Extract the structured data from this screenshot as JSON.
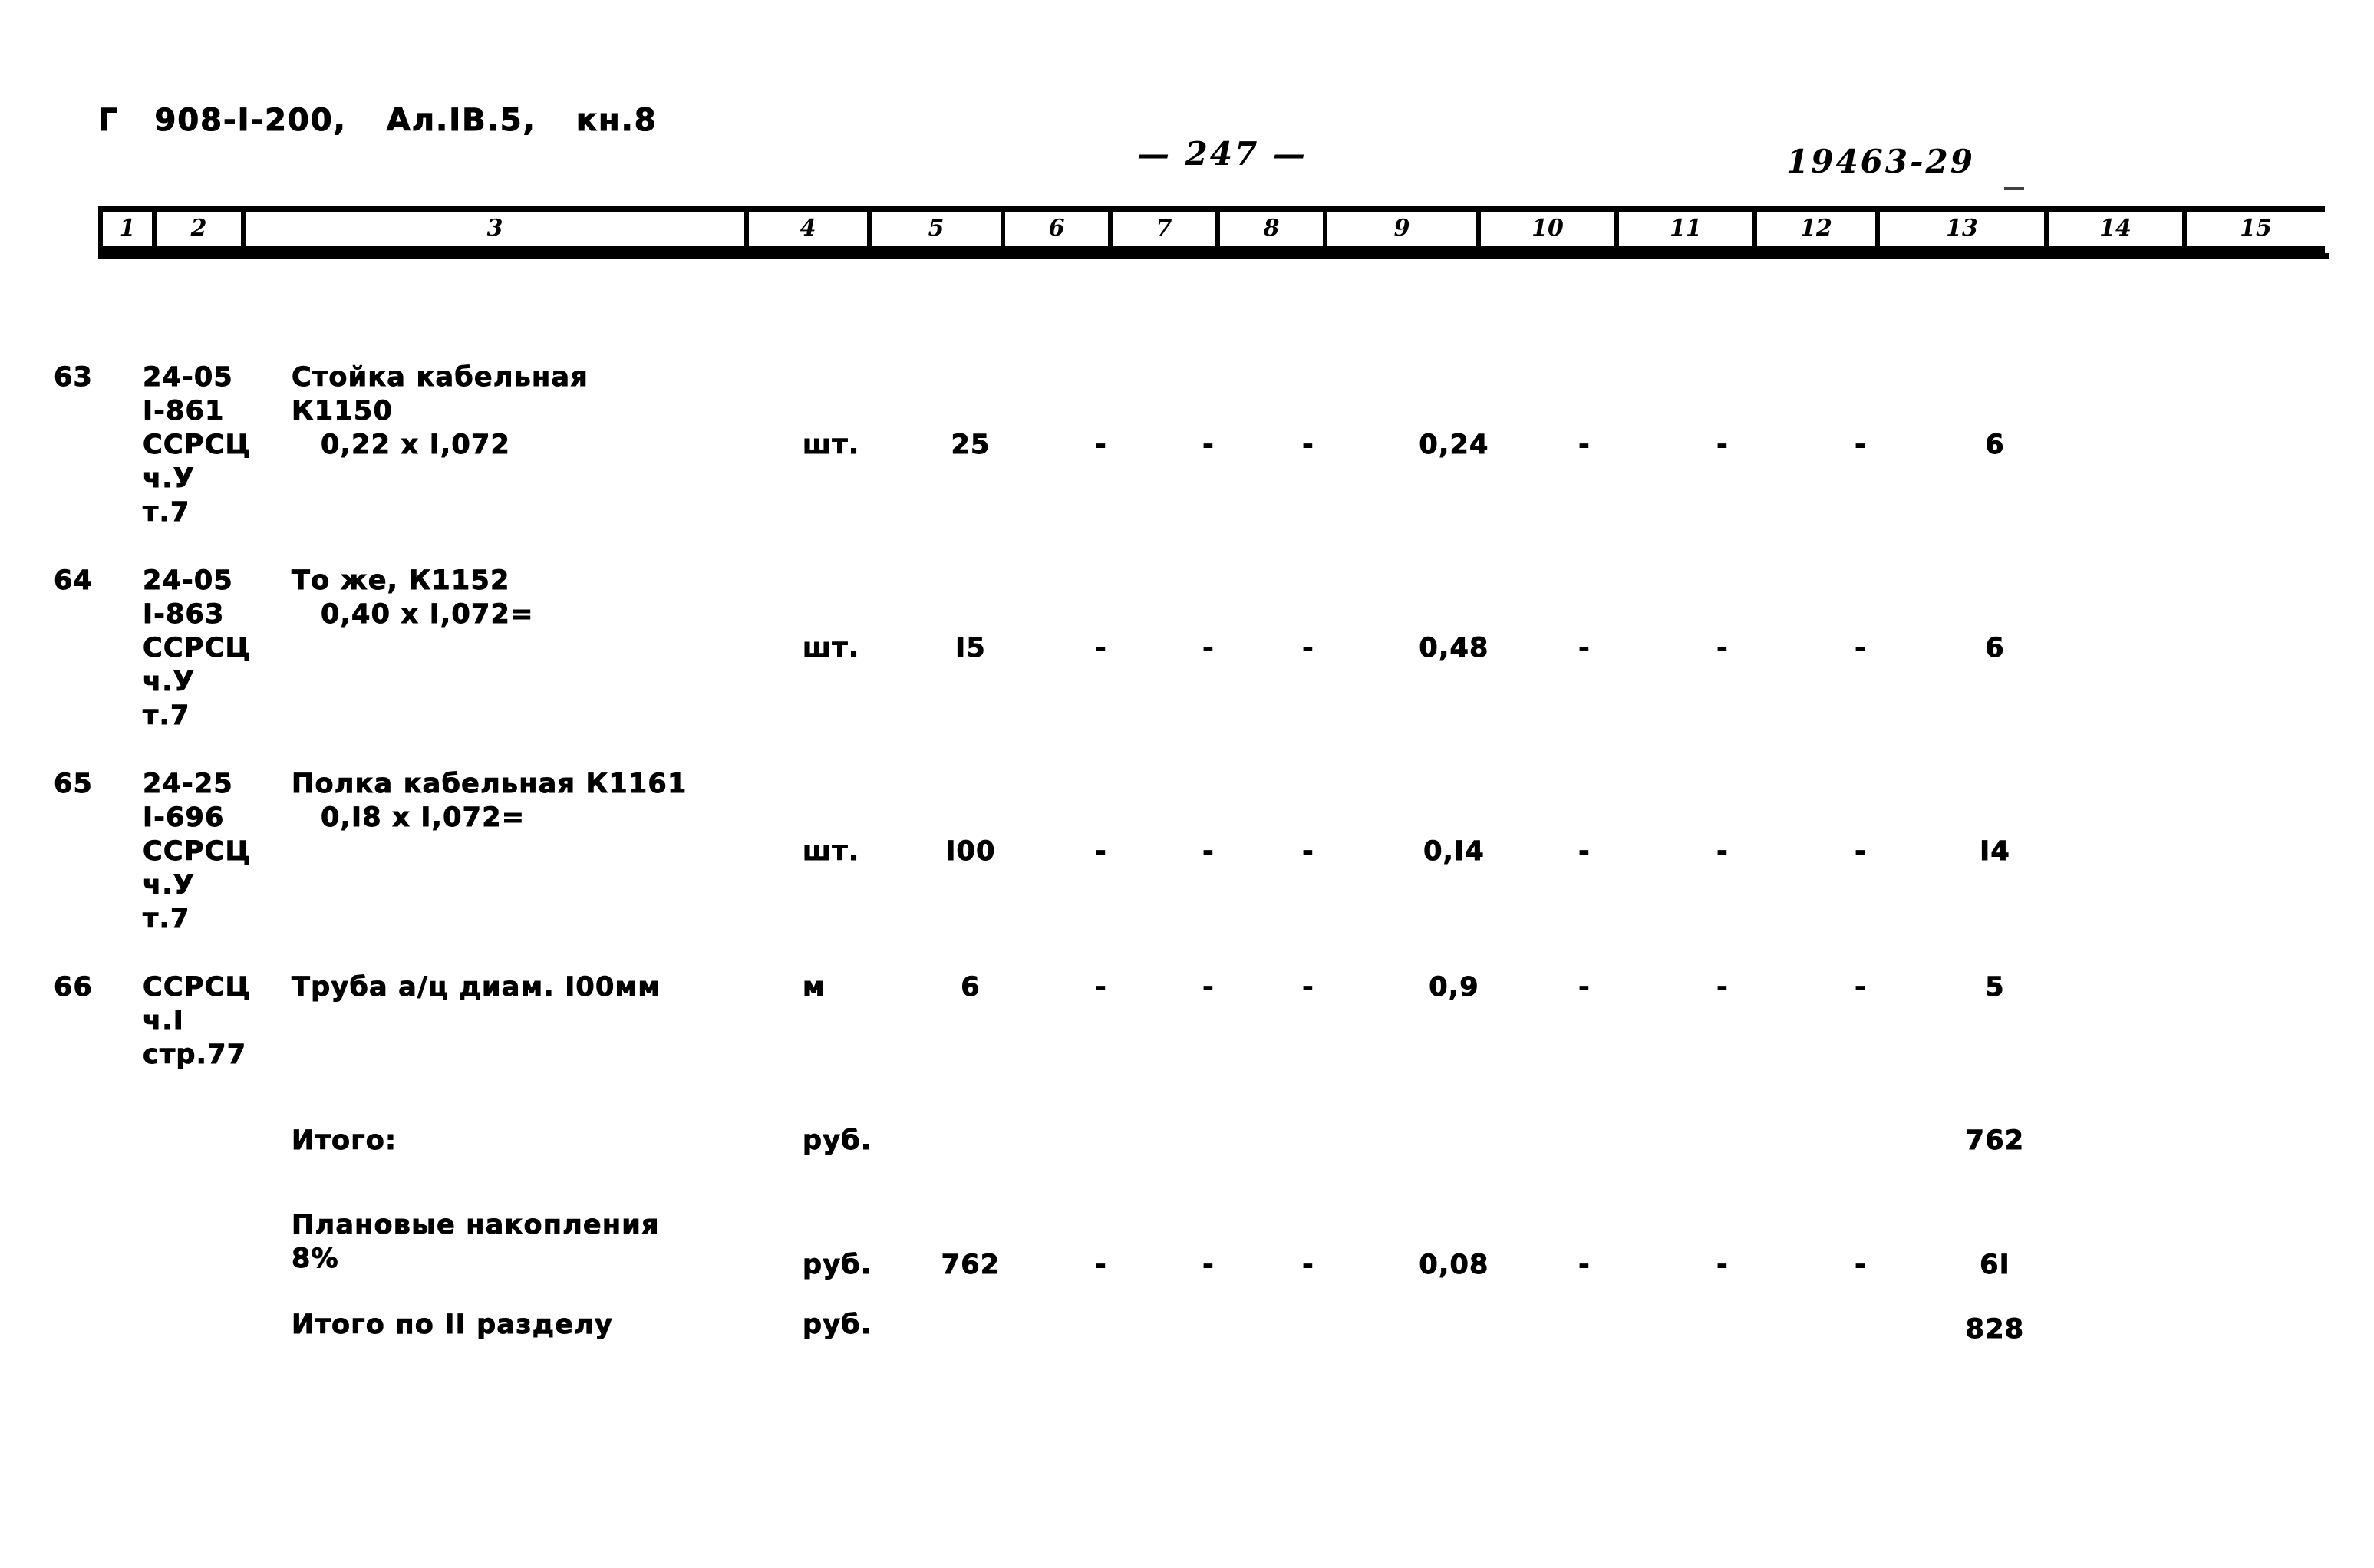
{
  "header": {
    "gamma_mark": "Г",
    "document_code": "908-I-200,",
    "album": "Ал.IB.5,",
    "book": "кн.8",
    "page_number": "— 247 —",
    "sheet_code": "19463-29"
  },
  "table": {
    "column_numbers": [
      "1",
      "2",
      "3",
      "4",
      "5",
      "6",
      "7",
      "8",
      "9",
      "10",
      "11",
      "12",
      "13",
      "14",
      "15"
    ],
    "rows": [
      {
        "num": "63",
        "code": "24-05\nI-861\nССРСЦ\nч.У\nт.7",
        "name_line1": "Стойка кабельная",
        "name_line2": "К1150",
        "name_line3": "0,22 х I,072",
        "unit": "шт.",
        "qty": "25",
        "c6": "-",
        "c7": "-",
        "c8": "-",
        "c9": "0,24",
        "c10": "-",
        "c11": "-",
        "c12": "-",
        "c13": "6",
        "c14": "",
        "c15": ""
      },
      {
        "num": "64",
        "code": "24-05\nI-863\nССРСЦ\nч.У\nт.7",
        "name_line1": "То же, К1152",
        "name_line2": "",
        "name_line3": "0,40 х I,072=",
        "unit": "шт.",
        "qty": "I5",
        "c6": "-",
        "c7": "-",
        "c8": "-",
        "c9": "0,48",
        "c10": "-",
        "c11": "-",
        "c12": "-",
        "c13": "6",
        "c14": "",
        "c15": ""
      },
      {
        "num": "65",
        "code": "24-25\nI-696\nССРСЦ\nч.У\nт.7",
        "name_line1": "Полка кабельная К1161",
        "name_line2": "",
        "name_line3": "0,I8 х I,072=",
        "unit": "шт.",
        "qty": "I00",
        "c6": "-",
        "c7": "-",
        "c8": "-",
        "c9": "0,I4",
        "c10": "-",
        "c11": "-",
        "c12": "-",
        "c13": "I4",
        "c14": "",
        "c15": ""
      },
      {
        "num": "66",
        "code": "ССРСЦ\nч.I\nстр.77",
        "name_line1": "Труба а/ц диам. I00мм",
        "name_line2": "",
        "name_line3": "",
        "unit": "м",
        "qty": "6",
        "c6": "-",
        "c7": "-",
        "c8": "-",
        "c9": "0,9",
        "c10": "-",
        "c11": "-",
        "c12": "-",
        "c13": "5",
        "c14": "",
        "c15": ""
      }
    ],
    "summary": [
      {
        "label": "Итого:",
        "unit": "руб.",
        "qty": "",
        "c6": "",
        "c7": "",
        "c8": "",
        "c9": "",
        "c10": "",
        "c11": "",
        "c12": "",
        "c13": "762"
      },
      {
        "label": "Плановые накопления\n8%",
        "unit": "руб.",
        "qty": "762",
        "c6": "-",
        "c7": "-",
        "c8": "-",
        "c9": "0,08",
        "c10": "-",
        "c11": "-",
        "c12": "-",
        "c13": "6I"
      },
      {
        "label": "Итого по II разделу",
        "unit": "руб.",
        "qty": "",
        "c6": "",
        "c7": "",
        "c8": "",
        "c9": "",
        "c10": "",
        "c11": "",
        "c12": "",
        "c13": "828"
      }
    ]
  }
}
